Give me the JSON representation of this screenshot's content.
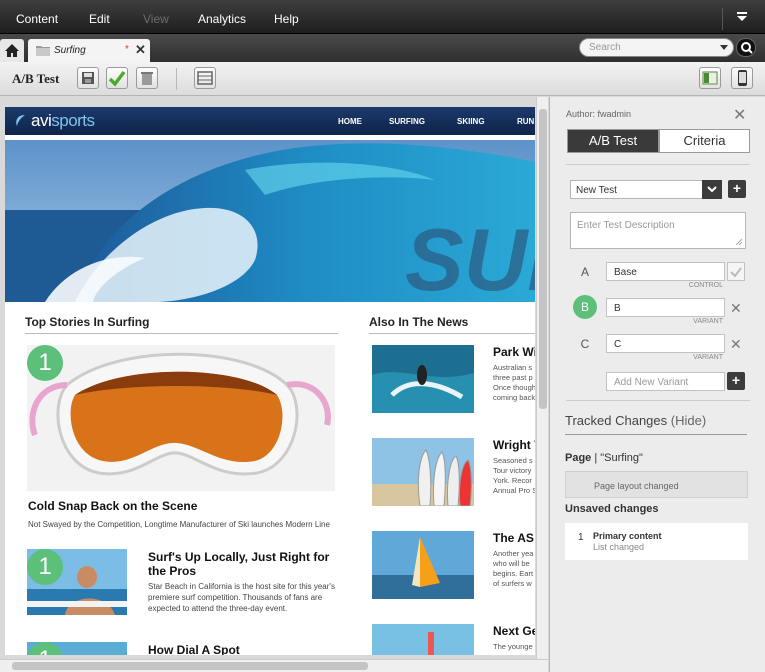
{
  "menubar": {
    "items": [
      {
        "label": "Content",
        "enabled": true
      },
      {
        "label": "Edit",
        "enabled": true
      },
      {
        "label": "View",
        "enabled": false
      },
      {
        "label": "Analytics",
        "enabled": true
      },
      {
        "label": "Help",
        "enabled": true
      }
    ]
  },
  "tabs": {
    "active_label": "Surfing",
    "modified_marker": "*"
  },
  "search": {
    "placeholder": "Search"
  },
  "toolbar": {
    "title": "A/B Test"
  },
  "site": {
    "logo_prefix": "avi",
    "logo_suffix": "sports",
    "nav": [
      "HOME",
      "SURFING",
      "SKIING",
      "RUN"
    ],
    "hero_text": "SURF",
    "top_stories_heading": "Top Stories In Surfing",
    "also_heading": "Also In The News",
    "stories": [
      {
        "rank": "1",
        "title": "Cold Snap Back on the Scene",
        "summary": "Not Swayed by the Competition, Longtime Manufacturer of Ski launches Modern Line"
      },
      {
        "rank": "1",
        "title": "Surf's Up Locally, Just Right for the Pros",
        "summary": "Star Beach in California is the host site for this year's premiere surf competition. Thousands of fans are expected to attend the three-day event."
      },
      {
        "rank": "1",
        "title": "How Dial A Spot",
        "summary": ""
      }
    ],
    "news": [
      {
        "title": "Park Wi",
        "summary": "Australian s\nthree past p\nOnce though\ncoming back"
      },
      {
        "title": "Wright V",
        "summary": "Seasoned s\nTour victory\nYork. Recor\nAnnual Pro S"
      },
      {
        "title": "The AS",
        "summary": "Another yea\nwho will be\nbegins. Eart\nof surfers w"
      },
      {
        "title": "Next Ge",
        "summary": "The younge"
      }
    ]
  },
  "panel": {
    "author": "Author: fwadmin",
    "tab_ab": "A/B Test",
    "tab_criteria": "Criteria",
    "test_select": "New Test",
    "description_placeholder": "Enter Test Description",
    "variants": [
      {
        "letter": "A",
        "name": "Base",
        "tag": "CONTROL",
        "selected": false
      },
      {
        "letter": "B",
        "name": "B",
        "tag": "VARIANT",
        "selected": true
      },
      {
        "letter": "C",
        "name": "C",
        "tag": "VARIANT",
        "selected": false
      }
    ],
    "add_variant_placeholder": "Add New Variant",
    "tracked_label": "Tracked Changes",
    "hide_link": "(Hide)",
    "page_label": "Page",
    "page_value": "| \"Surfing\"",
    "page_change": "Page layout changed",
    "unsaved_label": "Unsaved changes",
    "unsaved_items": [
      {
        "num": "1",
        "title": "Primary content",
        "detail": "List changed"
      }
    ]
  },
  "colors": {
    "accent_green": "#5cc07a",
    "dark": "#3a3a3a",
    "site_header": "#1b3a6c"
  }
}
